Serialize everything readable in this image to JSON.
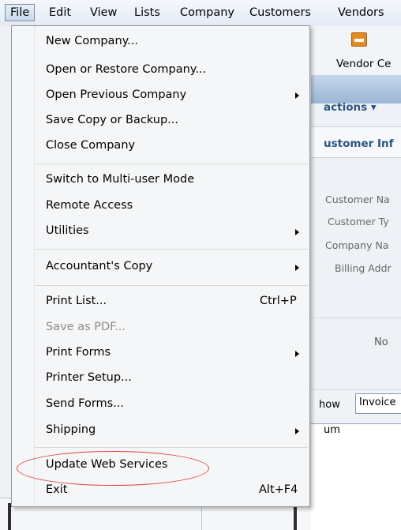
{
  "menubar": {
    "items": [
      "File",
      "Edit",
      "View",
      "Lists",
      "Company",
      "Customers",
      "Vendors"
    ]
  },
  "background": {
    "toolbar_button": "Vendor Ce",
    "actions_label": "actions ▾",
    "customer_info_header": "ustomer Inf",
    "labels": [
      "Customer Na",
      "Customer Ty",
      "Company Na",
      "Billing Addr"
    ],
    "no_label": "No",
    "show_label": "how",
    "show_value": "Invoice",
    "num_col": "um"
  },
  "file_menu": {
    "items": [
      {
        "label": "New Company...",
        "shortcut": "",
        "submenu": false,
        "disabled": false
      },
      {
        "label": "Open or Restore Company...",
        "shortcut": "",
        "submenu": false,
        "disabled": false
      },
      {
        "label": "Open Previous Company",
        "shortcut": "",
        "submenu": true,
        "disabled": false
      },
      {
        "label": "Save Copy or Backup...",
        "shortcut": "",
        "submenu": false,
        "disabled": false
      },
      {
        "label": "Close Company",
        "shortcut": "",
        "submenu": false,
        "disabled": false
      },
      {
        "label": "Switch to Multi-user Mode",
        "shortcut": "",
        "submenu": false,
        "disabled": false
      },
      {
        "label": "Remote Access",
        "shortcut": "",
        "submenu": false,
        "disabled": false
      },
      {
        "label": "Utilities",
        "shortcut": "",
        "submenu": true,
        "disabled": false
      },
      {
        "label": "Accountant's Copy",
        "shortcut": "",
        "submenu": true,
        "disabled": false
      },
      {
        "label": "Print List...",
        "shortcut": "Ctrl+P",
        "submenu": false,
        "disabled": false
      },
      {
        "label": "Save as PDF...",
        "shortcut": "",
        "submenu": false,
        "disabled": true
      },
      {
        "label": "Print Forms",
        "shortcut": "",
        "submenu": true,
        "disabled": false
      },
      {
        "label": "Printer Setup...",
        "shortcut": "",
        "submenu": false,
        "disabled": false
      },
      {
        "label": "Send Forms...",
        "shortcut": "",
        "submenu": false,
        "disabled": false
      },
      {
        "label": "Shipping",
        "shortcut": "",
        "submenu": true,
        "disabled": false
      },
      {
        "label": "Update Web Services",
        "shortcut": "",
        "submenu": false,
        "disabled": false,
        "highlighted": true
      },
      {
        "label": "Exit",
        "shortcut": "Alt+F4",
        "submenu": false,
        "disabled": false
      }
    ]
  },
  "colors": {
    "highlight_circle": "#e1403a",
    "accent_text": "#2a567f"
  }
}
